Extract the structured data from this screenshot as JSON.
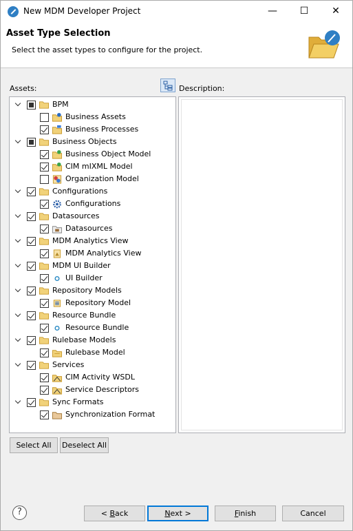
{
  "window": {
    "title": "New MDM Developer Project"
  },
  "header": {
    "title": "Asset Type Selection",
    "subtitle": "Select the asset types to configure for the project."
  },
  "labels": {
    "assets": "Assets:",
    "description": "Description:"
  },
  "tree": [
    {
      "label": "BPM",
      "level": 0,
      "state": "partial",
      "icon": "folder-icon"
    },
    {
      "label": "Business Assets",
      "level": 1,
      "state": "unchecked",
      "icon": "business-assets-icon"
    },
    {
      "label": "Business Processes",
      "level": 1,
      "state": "checked",
      "icon": "business-processes-icon"
    },
    {
      "label": "Business Objects",
      "level": 0,
      "state": "partial",
      "icon": "folder-icon"
    },
    {
      "label": "Business Object Model",
      "level": 1,
      "state": "checked",
      "icon": "business-object-model-icon"
    },
    {
      "label": "CIM mIXML Model",
      "level": 1,
      "state": "checked",
      "icon": "cim-model-icon"
    },
    {
      "label": "Organization Model",
      "level": 1,
      "state": "unchecked",
      "icon": "organization-model-icon"
    },
    {
      "label": "Configurations",
      "level": 0,
      "state": "checked",
      "icon": "folder-icon"
    },
    {
      "label": "Configurations",
      "level": 1,
      "state": "checked",
      "icon": "configuration-gear-icon"
    },
    {
      "label": "Datasources",
      "level": 0,
      "state": "checked",
      "icon": "folder-icon"
    },
    {
      "label": "Datasources",
      "level": 1,
      "state": "checked",
      "icon": "datasource-icon"
    },
    {
      "label": "MDM Analytics View",
      "level": 0,
      "state": "checked",
      "icon": "folder-icon"
    },
    {
      "label": "MDM Analytics View",
      "level": 1,
      "state": "checked",
      "icon": "analytics-view-icon"
    },
    {
      "label": "MDM UI Builder",
      "level": 0,
      "state": "checked",
      "icon": "folder-icon"
    },
    {
      "label": "UI Builder",
      "level": 1,
      "state": "checked",
      "icon": "ui-builder-dot-icon"
    },
    {
      "label": "Repository Models",
      "level": 0,
      "state": "checked",
      "icon": "folder-icon"
    },
    {
      "label": "Repository Model",
      "level": 1,
      "state": "checked",
      "icon": "repository-model-icon"
    },
    {
      "label": "Resource Bundle",
      "level": 0,
      "state": "checked",
      "icon": "folder-icon"
    },
    {
      "label": "Resource Bundle",
      "level": 1,
      "state": "checked",
      "icon": "resource-bundle-dot-icon"
    },
    {
      "label": "Rulebase Models",
      "level": 0,
      "state": "checked",
      "icon": "folder-icon"
    },
    {
      "label": "Rulebase Model",
      "level": 1,
      "state": "checked",
      "icon": "rulebase-model-icon"
    },
    {
      "label": "Services",
      "level": 0,
      "state": "checked",
      "icon": "folder-icon"
    },
    {
      "label": "CIM Activity WSDL",
      "level": 1,
      "state": "checked",
      "icon": "wsdl-icon"
    },
    {
      "label": "Service Descriptors",
      "level": 1,
      "state": "checked",
      "icon": "service-descriptor-icon"
    },
    {
      "label": "Sync Formats",
      "level": 0,
      "state": "checked",
      "icon": "folder-icon"
    },
    {
      "label": "Synchronization Format",
      "level": 1,
      "state": "checked",
      "icon": "sync-format-icon"
    }
  ],
  "buttons": {
    "select_all": "Select All",
    "deselect_all": "Deselect All",
    "back_prefix": "< ",
    "back_mn": "B",
    "back_rest": "ack",
    "next_mn": "N",
    "next_rest": "ext >",
    "finish_mn": "F",
    "finish_rest": "inish",
    "cancel": "Cancel",
    "help": "?"
  },
  "colors": {
    "folder": "#e8c15a",
    "accent": "#0078d7",
    "checkbox_border": "#333333"
  }
}
